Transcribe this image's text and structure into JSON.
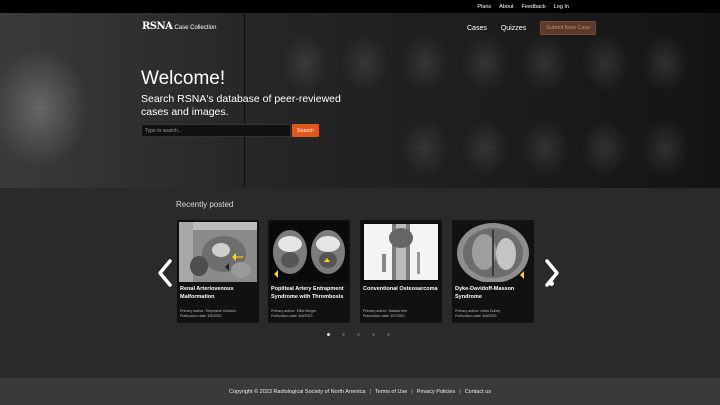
{
  "topbar": {
    "plans": "Plans",
    "about": "About",
    "feedback": "Feedback",
    "login": "Log In"
  },
  "header": {
    "logo_mark": "RSNA",
    "logo_sub": "Case Collection",
    "nav": {
      "cases": "Cases",
      "quizzes": "Quizzes",
      "submit": "Submit New Case"
    }
  },
  "hero": {
    "welcome": "Welcome!",
    "tagline": "Search RSNA's database of peer-reviewed cases and images.",
    "search_placeholder": "Type to search...",
    "search_button": "Search"
  },
  "recent": {
    "title": "Recently posted",
    "cards": [
      {
        "title": "Renal Arteriovenous Malformation",
        "author": "Primary author: Stephanie Goldwin",
        "date": "Publication date: 6/5/2023"
      },
      {
        "title": "Popliteal Artery Entrapment Syndrome with Thrombosis",
        "author": "Primary author: Elliot Berger",
        "date": "Publication date: 6/6/2023"
      },
      {
        "title": "Conventional Osteosarcoma",
        "author": "Primary author: Natalia Kerr",
        "date": "Publication date: 6/7/2023"
      },
      {
        "title": "Dyke-Davidoff-Masson Syndrome",
        "author": "Primary author: Arfan Dubey",
        "date": "Publication date: 6/8/2023"
      }
    ],
    "dot_count": 5,
    "active_dot": 1
  },
  "footer": {
    "copyright": "Copyright © 2023 Radiological Society of North America",
    "terms": "Terms of Use",
    "privacy": "Privacy Policies",
    "contact": "Contact us",
    "sep": "|"
  },
  "colors": {
    "accent": "#e0581f",
    "submit_bg": "#5a3a2c",
    "page_bg": "#2a2a2a"
  }
}
